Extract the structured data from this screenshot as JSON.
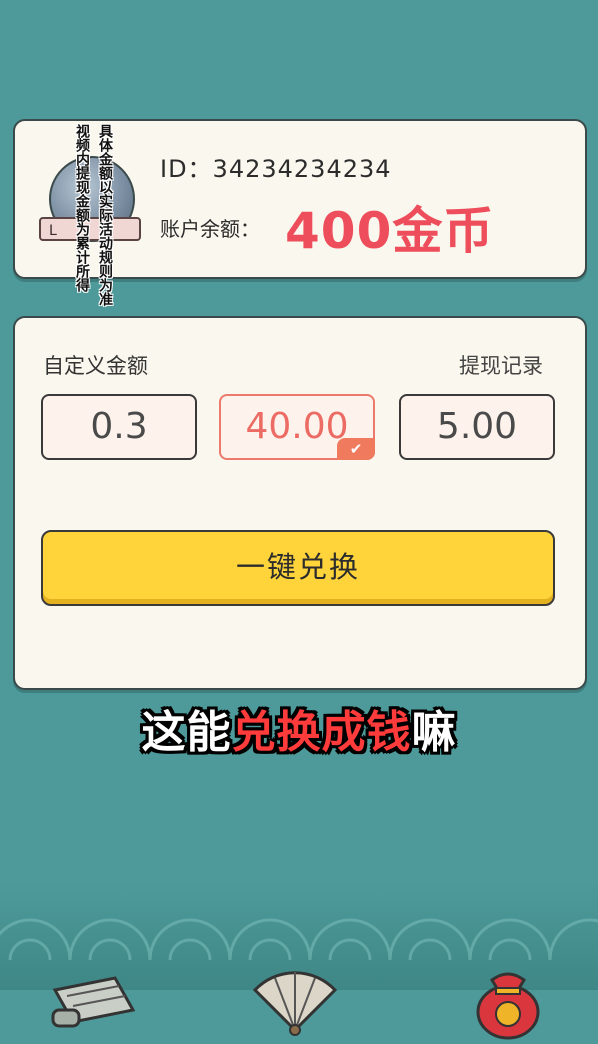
{
  "profile": {
    "ribbon_text": "L",
    "id_text": "ID：34234234234",
    "balance_label": "账户余额：",
    "balance_value": "400金币"
  },
  "notices": {
    "line1": "具体金额以实际活动规则为准",
    "line2": "视频内提现金额为累计所得"
  },
  "exchange": {
    "custom_amount_label": "自定义金额",
    "withdraw_record_label": "提现记录",
    "amounts": [
      {
        "value": "0.3",
        "selected": false
      },
      {
        "value": "40.00",
        "selected": true
      },
      {
        "value": "5.00",
        "selected": false
      }
    ],
    "check_mark": "✔",
    "button_label": "一键兑换"
  },
  "subtitle": {
    "part1": "这能",
    "part2": "兑换成钱",
    "part3": "嘛"
  },
  "colors": {
    "background": "#4e9a9a",
    "accent_red": "#ee4e5b",
    "button_yellow": "#ffd43b"
  },
  "bottom_nav": {
    "icons": [
      "scroll-icon",
      "fan-icon",
      "lucky-bag-icon"
    ]
  }
}
